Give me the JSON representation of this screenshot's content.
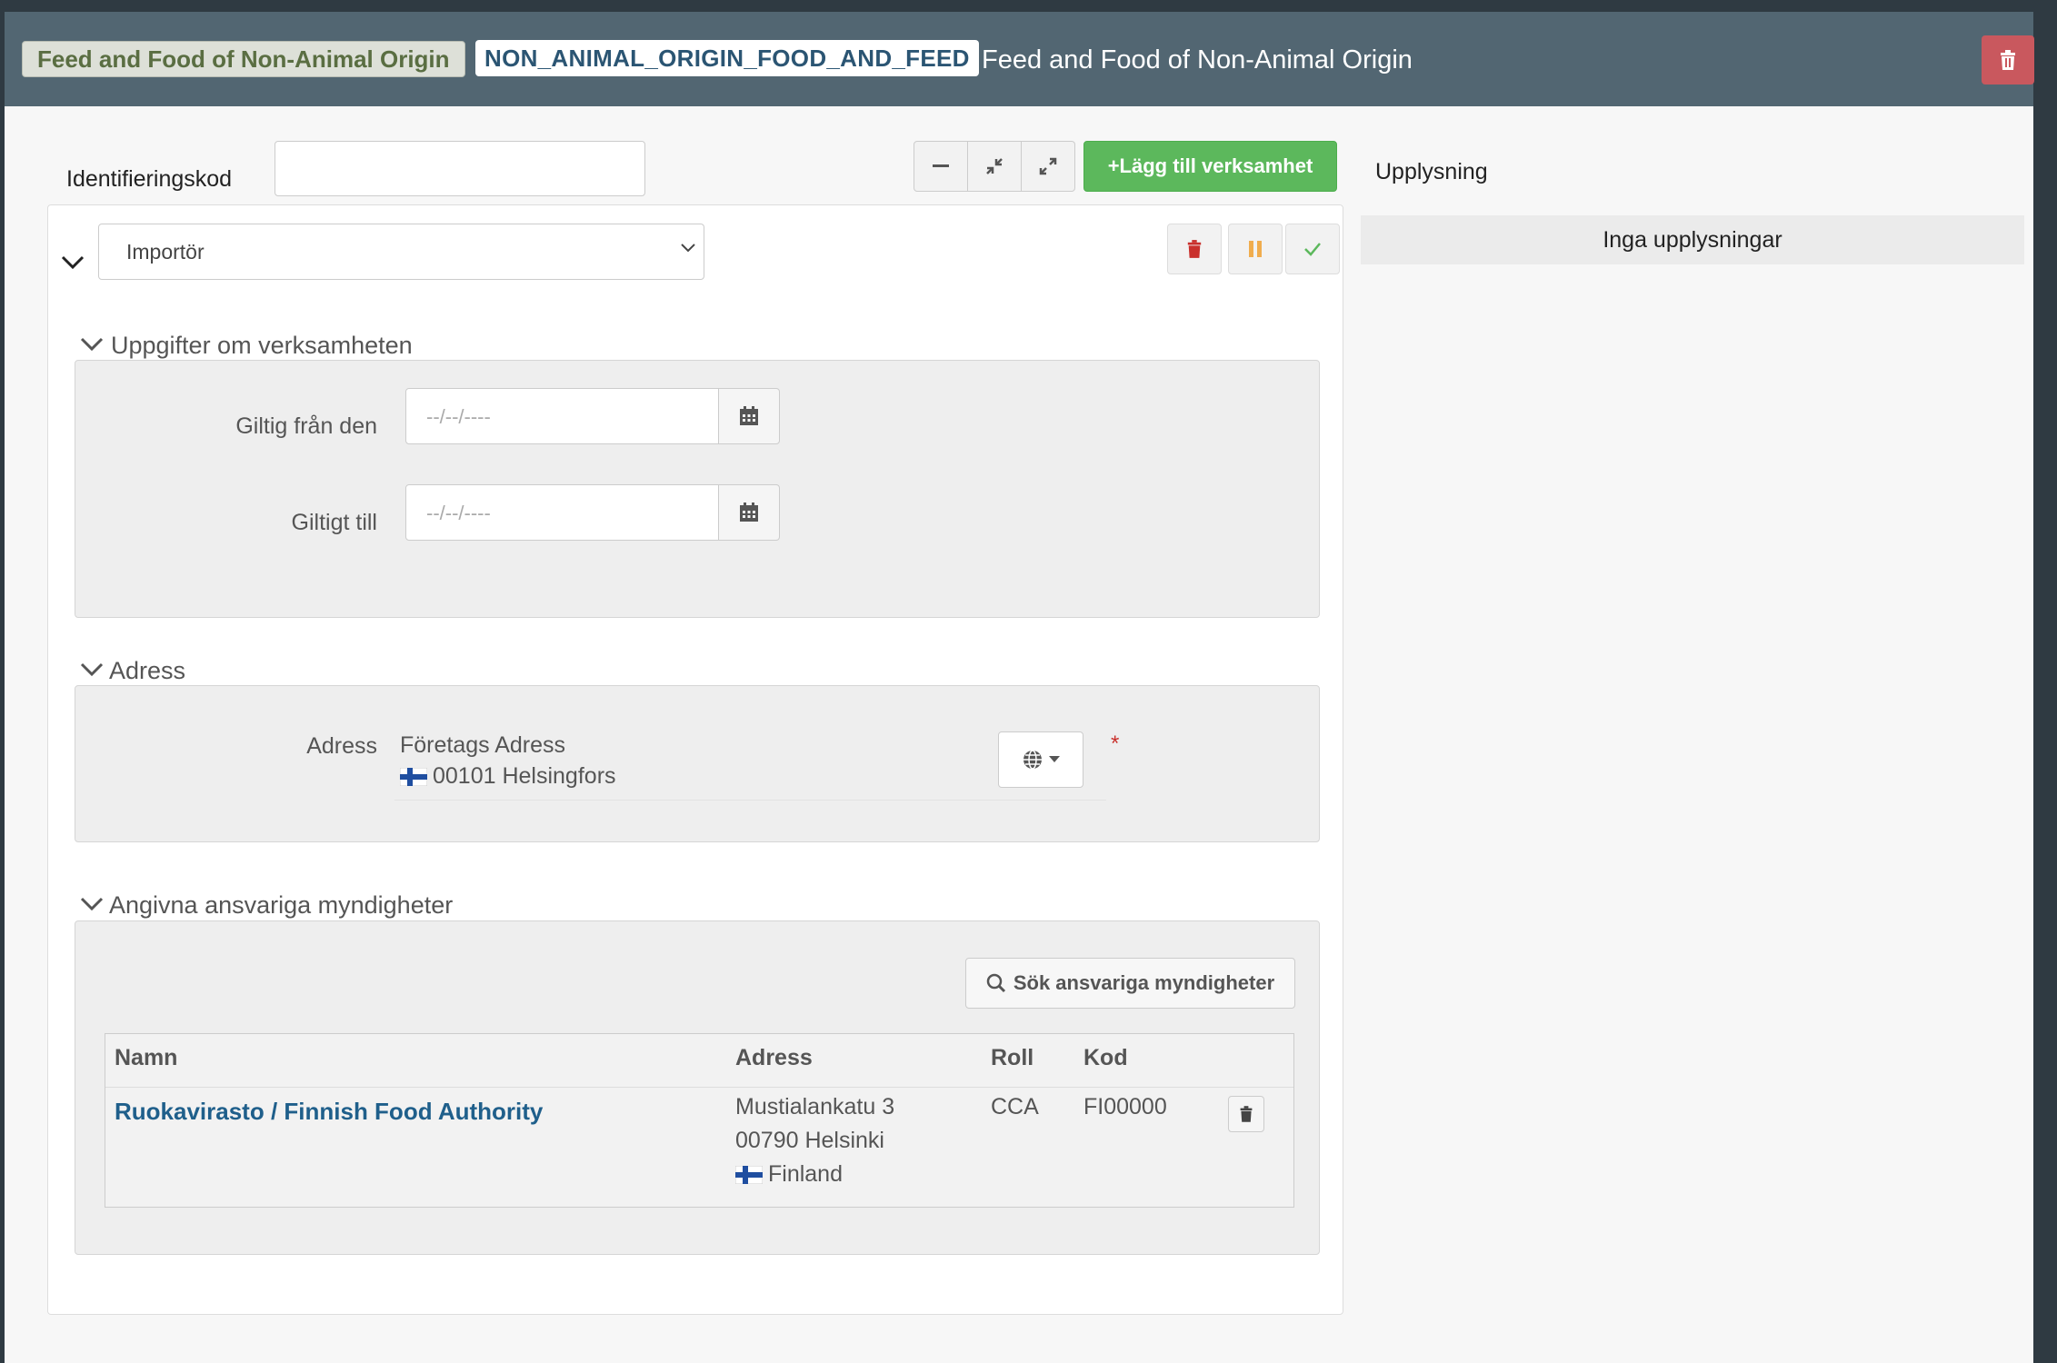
{
  "header": {
    "category_chip": "Feed and Food of Non-Animal Origin",
    "code_chip": "NON_ANIMAL_ORIGIN_FOOD_AND_FEED",
    "title": "Feed and Food of Non-Animal Origin",
    "delete_icon": "trash-icon"
  },
  "identification": {
    "label": "Identifieringskod",
    "value": ""
  },
  "toolbar": {
    "collapse_icon": "minus-icon",
    "compress_icon": "compress-icon",
    "expand_icon": "expand-icon",
    "add_label": "+Lägg till verksamhet"
  },
  "info": {
    "title": "Upplysning",
    "empty_text": "Inga upplysningar"
  },
  "activity": {
    "type_selected": "Importör",
    "actions": [
      "trash-icon",
      "pause-icon",
      "check-icon"
    ]
  },
  "sections": {
    "details": {
      "title": "Uppgifter om verksamheten",
      "valid_from_label": "Giltig från den",
      "valid_from_placeholder": "--/--/----",
      "valid_to_label": "Giltigt till",
      "valid_to_placeholder": "--/--/----"
    },
    "address": {
      "title": "Adress",
      "label": "Adress",
      "line1": "Företags Adress",
      "line2": "00101 Helsingfors",
      "required_mark": "*"
    },
    "authorities": {
      "title": "Angivna ansvariga myndigheter",
      "search_label": "Sök ansvariga myndigheter",
      "columns": [
        "Namn",
        "Adress",
        "Roll",
        "Kod"
      ],
      "rows": [
        {
          "name": "Ruokavirasto / Finnish Food Authority",
          "address_line1": "Mustialankatu 3",
          "address_line2": "00790 Helsinki",
          "country": "Finland",
          "role": "CCA",
          "code": "FI00000"
        }
      ]
    }
  },
  "colors": {
    "header_bg": "#526672",
    "add_button": "#5cb85c",
    "link": "#1f5f8b",
    "danger": "#c9302c",
    "warning": "#f0ad4e"
  }
}
